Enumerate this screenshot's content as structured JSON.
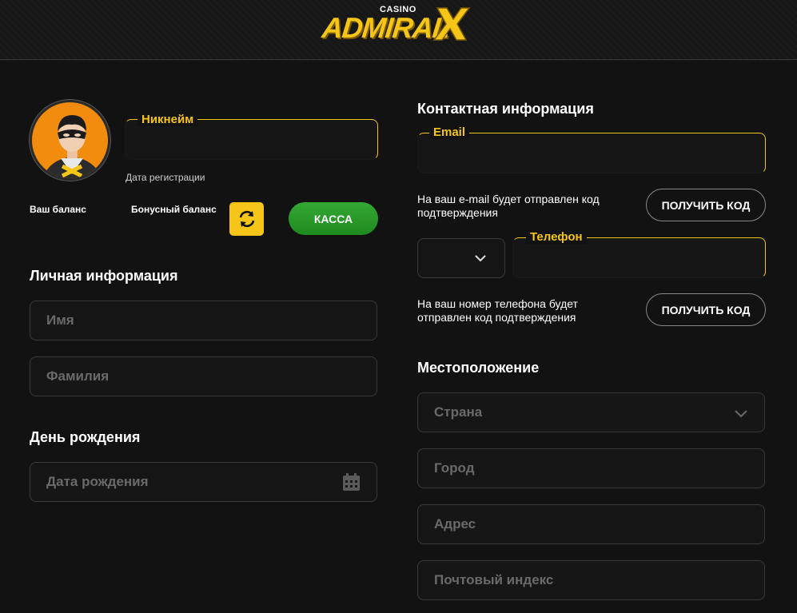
{
  "header": {
    "logo_small": "CASINO",
    "logo_main": "ADMIRAL",
    "brand_color": "#f5c518"
  },
  "profile": {
    "nickname_label": "Никнейм",
    "nickname_value": "",
    "registration_date_label": "Дата регистрации",
    "balance_label": "Ваш баланс",
    "bonus_balance_label": "Бонусный баланс",
    "refresh_icon": "refresh-icon",
    "cashier_button": "КАССА"
  },
  "personal": {
    "title": "Личная информация",
    "first_name_placeholder": "Имя",
    "last_name_placeholder": "Фамилия"
  },
  "birthday": {
    "title": "День рождения",
    "date_placeholder": "Дата рождения",
    "calendar_icon": "calendar-icon"
  },
  "contact": {
    "title": "Контактная информация",
    "email_label": "Email",
    "email_value": "",
    "email_note": "На ваш e-mail будет отправлен код подтверждения",
    "email_code_button": "ПОЛУЧИТЬ КОД",
    "phone_label": "Телефон",
    "phone_value": "",
    "phone_note": "На ваш номер телефона будет отправлен код подтверждения",
    "phone_code_button": "ПОЛУЧИТЬ КОД"
  },
  "location": {
    "title": "Местоположение",
    "country_placeholder": "Страна",
    "city_placeholder": "Город",
    "address_placeholder": "Адрес",
    "postal_placeholder": "Почтовый индекс"
  }
}
